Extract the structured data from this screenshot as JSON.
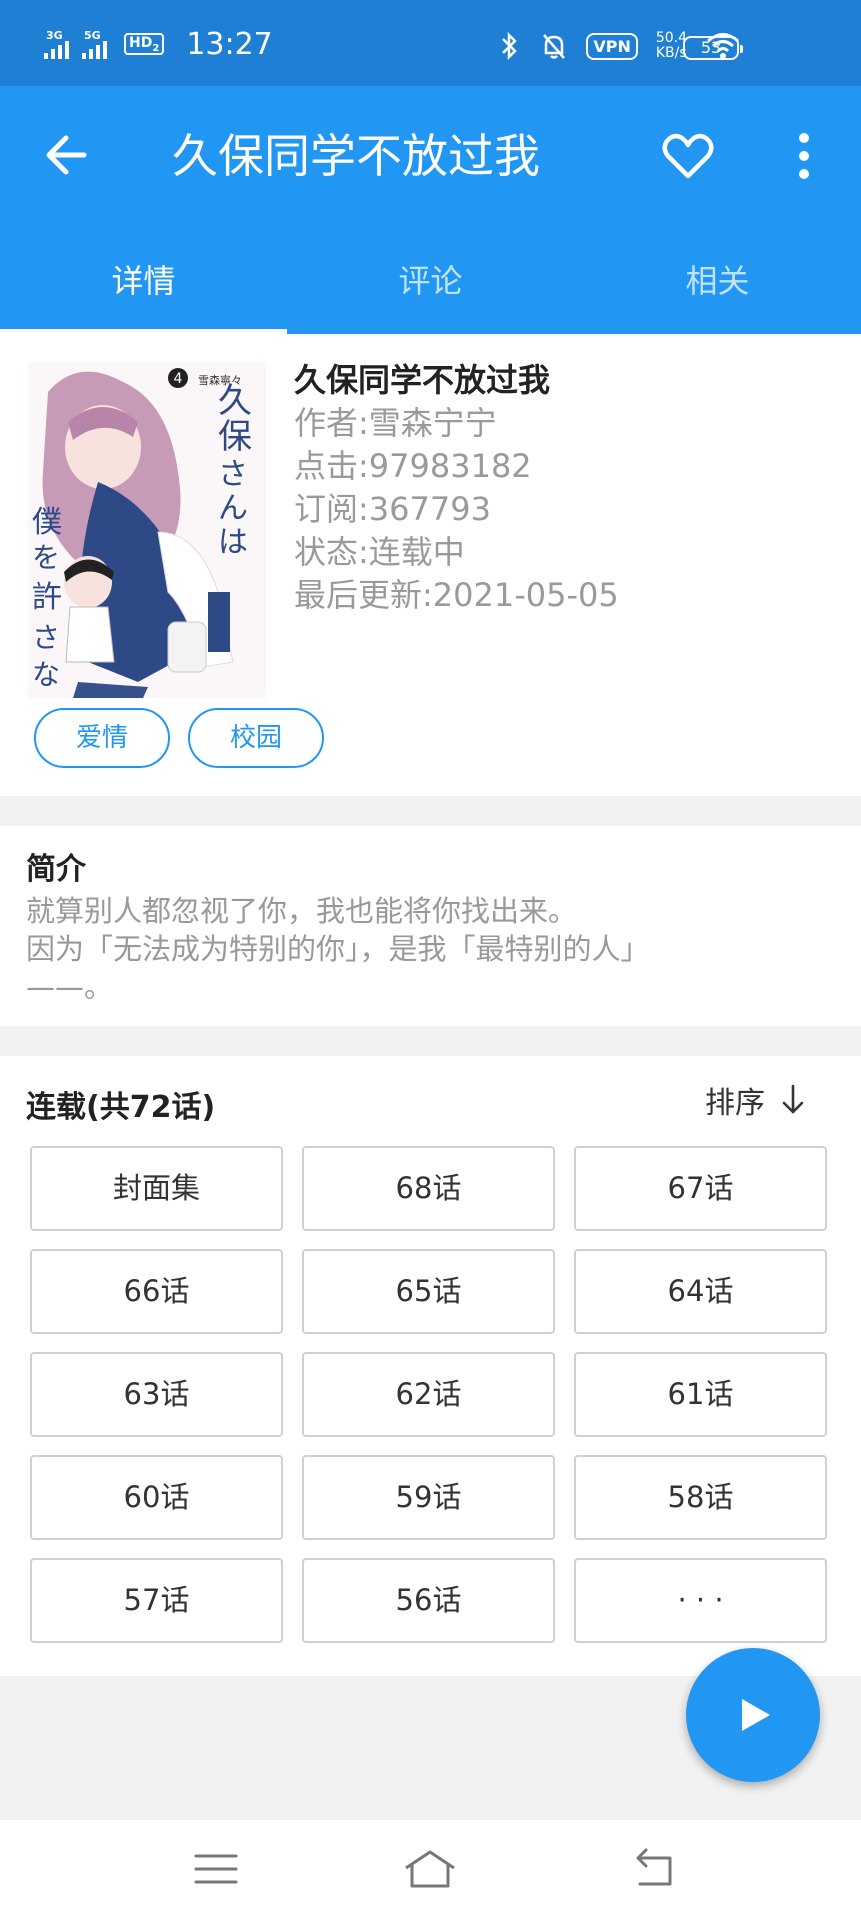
{
  "status_bar": {
    "network_1": "3G",
    "network_2": "5G",
    "hd": "HD",
    "hd_sub": "2",
    "time": "13:27",
    "vpn": "VPN",
    "speed_value": "50.4",
    "speed_unit": "KB/s",
    "battery": "53"
  },
  "app_bar": {
    "title": "久保同学不放过我",
    "tabs": [
      "详情",
      "评论",
      "相关"
    ],
    "active_tab": 0
  },
  "detail": {
    "cover_text": {
      "volume": "4",
      "title_jp": "久保さんは僕を許さない",
      "author_jp": "雪森寧々"
    },
    "name": "久保同学不放过我",
    "author": "作者:雪森宁宁",
    "clicks": "点击:97983182",
    "subscriptions": "订阅:367793",
    "status": "状态:连载中",
    "last_update": "最后更新:2021-05-05",
    "tags": [
      "爱情",
      "校园"
    ]
  },
  "intro": {
    "heading": "简介",
    "line1": "就算别人都忽视了你，我也能将你找出来。",
    "line2": "因为「无法成为特别的你」，是我「最特别的人」",
    "line3": "——。"
  },
  "chapters": {
    "heading": "连载(共72话)",
    "sort_label": "排序",
    "items": [
      "封面集",
      "68话",
      "67话",
      "66话",
      "65话",
      "64话",
      "63话",
      "62话",
      "61话",
      "60话",
      "59话",
      "58话",
      "57话",
      "56话",
      "· · ·"
    ]
  },
  "colors": {
    "primary": "#2196f3",
    "status_bar": "#1f7fd4"
  },
  "icons": {
    "back": "arrow-left-icon",
    "favorite": "heart-outline-icon",
    "more": "more-vertical-icon",
    "sort": "arrow-down-icon",
    "play": "play-icon",
    "nav_menu": "menu-icon",
    "nav_home": "home-icon",
    "nav_back": "back-icon"
  }
}
